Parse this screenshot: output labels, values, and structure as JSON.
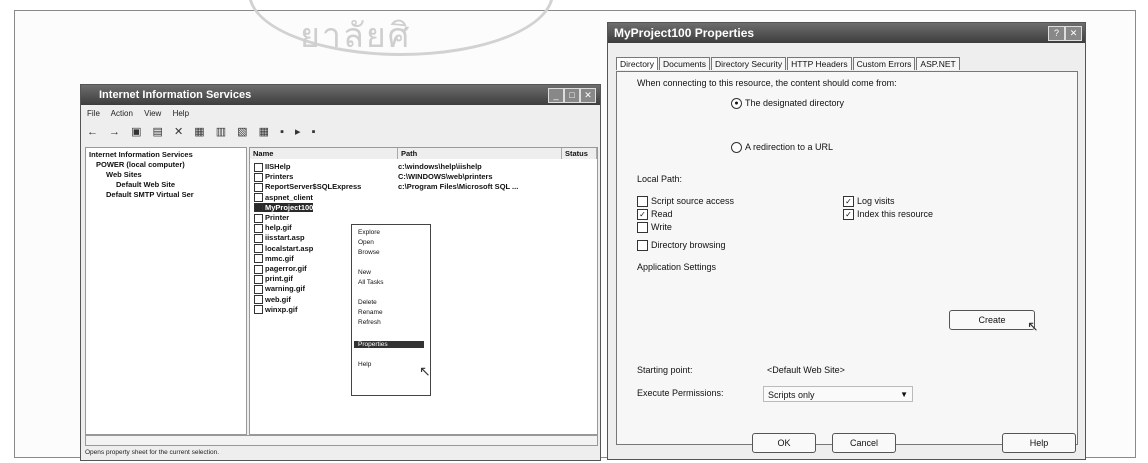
{
  "watermark": {
    "text": "ยาลัยศิ",
    "color": "#cfcfcf"
  },
  "iis": {
    "title": "Internet Information Services",
    "menu": [
      "File",
      "Action",
      "View",
      "Help"
    ],
    "toolbar_glyphs": "← → ▣ ▤ ✕ ▦ ▥ ▧ ▦ ▪ ▸ ▪",
    "tree": [
      "Internet Information Services",
      "POWER (local computer)",
      "Web Sites",
      "Default Web Site",
      "Default SMTP Virtual Ser"
    ],
    "columns": [
      "Name",
      "Path",
      "Status"
    ],
    "rows": [
      {
        "name": "IISHelp",
        "path": "c:\\windows\\help\\iishelp"
      },
      {
        "name": "Printers",
        "path": "C:\\WINDOWS\\web\\printers"
      },
      {
        "name": "ReportServer$SQLExpress",
        "path": "c:\\Program Files\\Microsoft SQL ..."
      },
      {
        "name": "aspnet_client",
        "path": ""
      },
      {
        "name": "MyProject100",
        "path": ""
      },
      {
        "name": "Printer",
        "path": ""
      },
      {
        "name": "help.gif",
        "path": ""
      },
      {
        "name": "iisstart.asp",
        "path": ""
      },
      {
        "name": "localstart.asp",
        "path": ""
      },
      {
        "name": "mmc.gif",
        "path": ""
      },
      {
        "name": "pagerror.gif",
        "path": ""
      },
      {
        "name": "print.gif",
        "path": ""
      },
      {
        "name": "warning.gif",
        "path": ""
      },
      {
        "name": "web.gif",
        "path": ""
      },
      {
        "name": "winxp.gif",
        "path": ""
      }
    ],
    "context_menu": [
      "Explore",
      "Open",
      "Browse",
      "New",
      "All Tasks",
      "Delete",
      "Rename",
      "Refresh",
      "Properties",
      "Help"
    ],
    "status": "Opens property sheet for the current selection."
  },
  "dialog": {
    "title": "MyProject100 Properties",
    "tabs": [
      "Directory",
      "Documents",
      "Directory Security",
      "HTTP Headers",
      "Custom Errors",
      "ASP.NET"
    ],
    "intro": "When connecting to this resource, the content should come from:",
    "radio_designated": "The designated directory",
    "radio_redirect": "A redirection to a URL",
    "local_path_label": "Local Path:",
    "checks": {
      "script_source": "Script source access",
      "read": "Read",
      "write": "Write",
      "dir_browsing": "Directory browsing",
      "log_visits": "Log visits",
      "index": "Index this resource"
    },
    "app_settings": "Application Settings",
    "create_button": "Create",
    "starting_point_label": "Starting point:",
    "starting_point_value": "<Default Web Site>",
    "execute_label": "Execute Permissions:",
    "execute_value": "Scripts only",
    "ok": "OK",
    "cancel": "Cancel",
    "help": "Help"
  }
}
